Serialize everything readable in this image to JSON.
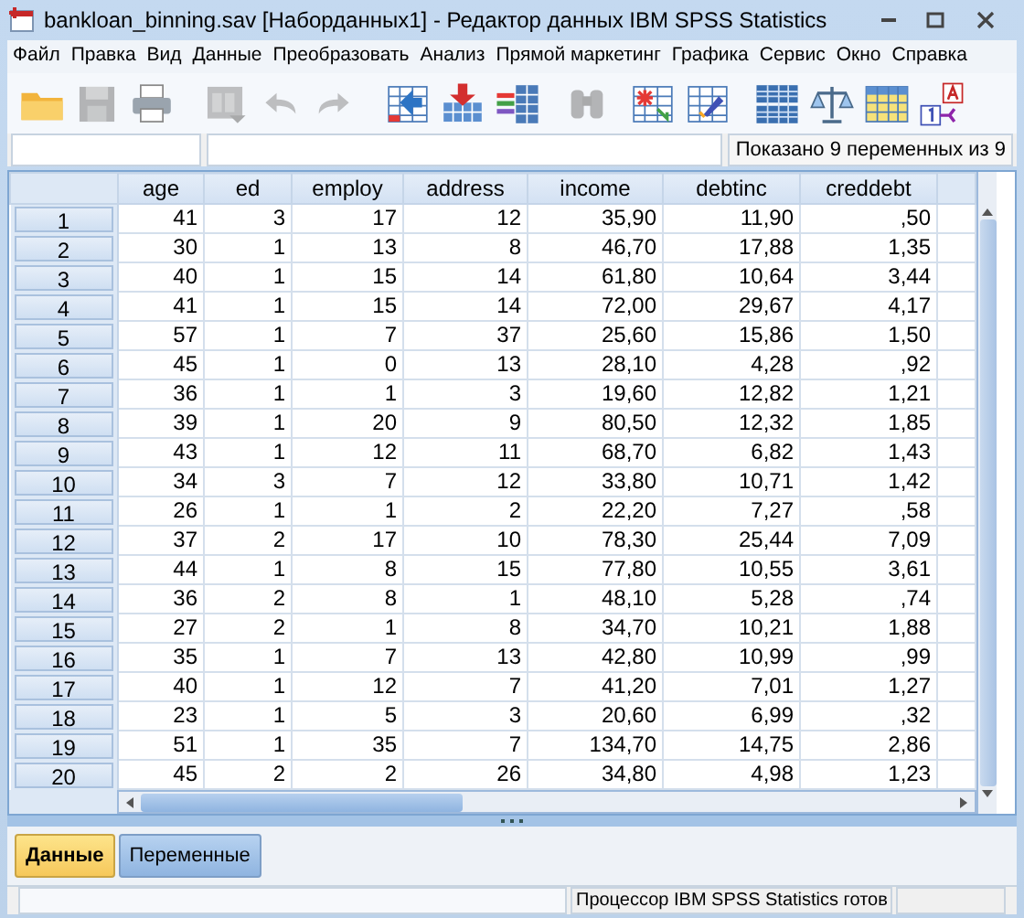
{
  "window": {
    "title": "bankloan_binning.sav [Наборданных1] - Редактор данных IBM SPSS Statistics"
  },
  "menu": [
    {
      "label": "Файл"
    },
    {
      "label": "Правка"
    },
    {
      "label": "Вид"
    },
    {
      "label": "Данные"
    },
    {
      "label": "Преобразовать"
    },
    {
      "label": "Анализ"
    },
    {
      "label": "Прямой маркетинг"
    },
    {
      "label": "Графика"
    },
    {
      "label": "Сервис"
    },
    {
      "label": "Окно"
    },
    {
      "label": "Справка"
    }
  ],
  "toolbar": [
    {
      "kind": "open",
      "disabled": false
    },
    {
      "kind": "save",
      "disabled": true
    },
    {
      "kind": "print",
      "disabled": false
    },
    {
      "kind": "recall",
      "disabled": true
    },
    {
      "kind": "undo",
      "disabled": true
    },
    {
      "kind": "redo",
      "disabled": true
    },
    {
      "kind": "gotocase",
      "disabled": false
    },
    {
      "kind": "gotovar",
      "disabled": false
    },
    {
      "kind": "variables",
      "disabled": false
    },
    {
      "kind": "find",
      "disabled": true
    },
    {
      "kind": "insertcase",
      "disabled": false
    },
    {
      "kind": "insertvar",
      "disabled": false
    },
    {
      "kind": "split",
      "disabled": false
    },
    {
      "kind": "weight",
      "disabled": false
    },
    {
      "kind": "select",
      "disabled": false
    },
    {
      "kind": "labels",
      "disabled": false
    }
  ],
  "variables_shown": "Показано 9 переменных из 9",
  "table": {
    "columns": [
      "age",
      "ed",
      "employ",
      "address",
      "income",
      "debtinc",
      "creddebt"
    ],
    "rows": [
      {
        "label": "1",
        "cells": [
          "41",
          "3",
          "17",
          "12",
          "35,90",
          "11,90",
          ",50"
        ]
      },
      {
        "label": "2",
        "cells": [
          "30",
          "1",
          "13",
          "8",
          "46,70",
          "17,88",
          "1,35"
        ]
      },
      {
        "label": "3",
        "cells": [
          "40",
          "1",
          "15",
          "14",
          "61,80",
          "10,64",
          "3,44"
        ]
      },
      {
        "label": "4",
        "cells": [
          "41",
          "1",
          "15",
          "14",
          "72,00",
          "29,67",
          "4,17"
        ]
      },
      {
        "label": "5",
        "cells": [
          "57",
          "1",
          "7",
          "37",
          "25,60",
          "15,86",
          "1,50"
        ]
      },
      {
        "label": "6",
        "cells": [
          "45",
          "1",
          "0",
          "13",
          "28,10",
          "4,28",
          ",92"
        ]
      },
      {
        "label": "7",
        "cells": [
          "36",
          "1",
          "1",
          "3",
          "19,60",
          "12,82",
          "1,21"
        ]
      },
      {
        "label": "8",
        "cells": [
          "39",
          "1",
          "20",
          "9",
          "80,50",
          "12,32",
          "1,85"
        ]
      },
      {
        "label": "9",
        "cells": [
          "43",
          "1",
          "12",
          "11",
          "68,70",
          "6,82",
          "1,43"
        ]
      },
      {
        "label": "10",
        "cells": [
          "34",
          "3",
          "7",
          "12",
          "33,80",
          "10,71",
          "1,42"
        ]
      },
      {
        "label": "11",
        "cells": [
          "26",
          "1",
          "1",
          "2",
          "22,20",
          "7,27",
          ",58"
        ]
      },
      {
        "label": "12",
        "cells": [
          "37",
          "2",
          "17",
          "10",
          "78,30",
          "25,44",
          "7,09"
        ]
      },
      {
        "label": "13",
        "cells": [
          "44",
          "1",
          "8",
          "15",
          "77,80",
          "10,55",
          "3,61"
        ]
      },
      {
        "label": "14",
        "cells": [
          "36",
          "2",
          "8",
          "1",
          "48,10",
          "5,28",
          ",74"
        ]
      },
      {
        "label": "15",
        "cells": [
          "27",
          "2",
          "1",
          "8",
          "34,70",
          "10,21",
          "1,88"
        ]
      },
      {
        "label": "16",
        "cells": [
          "35",
          "1",
          "7",
          "13",
          "42,80",
          "10,99",
          ",99"
        ]
      },
      {
        "label": "17",
        "cells": [
          "40",
          "1",
          "12",
          "7",
          "41,20",
          "7,01",
          "1,27"
        ]
      },
      {
        "label": "18",
        "cells": [
          "23",
          "1",
          "5",
          "3",
          "20,60",
          "6,99",
          ",32"
        ]
      },
      {
        "label": "19",
        "cells": [
          "51",
          "1",
          "35",
          "7",
          "134,70",
          "14,75",
          "2,86"
        ]
      },
      {
        "label": "20",
        "cells": [
          "45",
          "2",
          "2",
          "26",
          "34,80",
          "4,98",
          "1,23"
        ]
      }
    ]
  },
  "tabs": [
    {
      "label": "Данные",
      "selected": true
    },
    {
      "label": "Переменные",
      "selected": false
    }
  ],
  "status_bar": "Процессор IBM SPSS Statistics готов"
}
